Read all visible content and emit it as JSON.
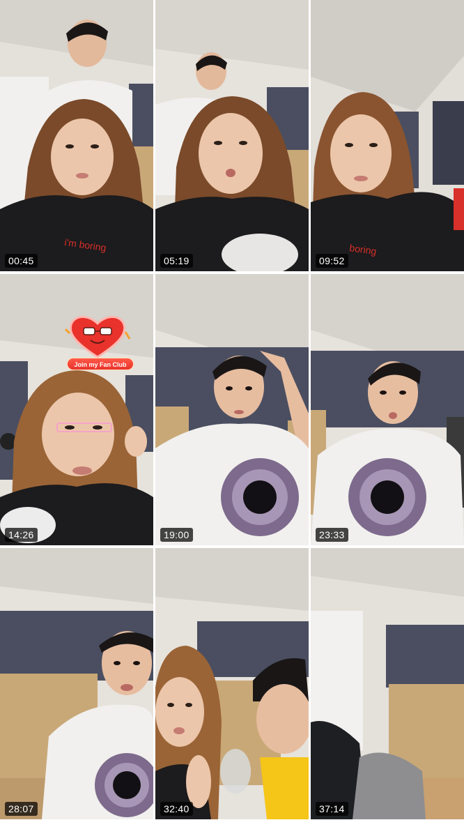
{
  "tiles": [
    {
      "timestamp": "00:45",
      "scene": "girl-with-boy-behind"
    },
    {
      "timestamp": "05:19",
      "scene": "girl-with-boy-behind"
    },
    {
      "timestamp": "09:52",
      "scene": "girl-alone"
    },
    {
      "timestamp": "14:26",
      "scene": "girl-glasses-filter",
      "fan_club_label": "Join my Fan Club"
    },
    {
      "timestamp": "19:00",
      "scene": "boy-eye-shirt"
    },
    {
      "timestamp": "23:33",
      "scene": "boy-eye-shirt"
    },
    {
      "timestamp": "28:07",
      "scene": "boy-eye-shirt"
    },
    {
      "timestamp": "32:40",
      "scene": "girl-and-boy"
    },
    {
      "timestamp": "37:14",
      "scene": "room-empty"
    }
  ],
  "colors": {
    "ceiling": "#d9d5cf",
    "wall": "#e6e2dc",
    "curtain": "#4a4e60",
    "wardrobe": "#c9a878",
    "shirt_black": "#1c1b1d",
    "shirt_white": "#f1f0ee",
    "hair_girl": "#7a4a2a",
    "hair_boy": "#1a1616",
    "skin": "#e9c2a6",
    "iris": "#7d6a8c",
    "badge_red": "#e8322b"
  }
}
